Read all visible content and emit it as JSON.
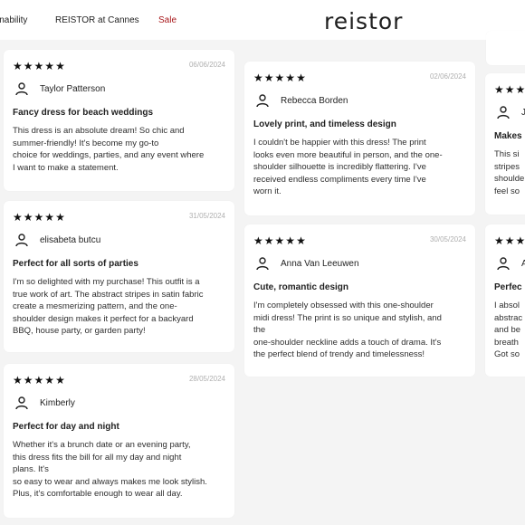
{
  "nav": {
    "sustainability": "inability",
    "cannes": "REISTOR at Cannes",
    "sale": "Sale",
    "logo": "reistor"
  },
  "reviews": [
    {
      "stars": 5,
      "date": "06/06/2024",
      "author": "Taylor Patterson",
      "title": "Fancy dress for beach weddings",
      "body": [
        "This dress is an absolute dream! So chic and",
        "summer-friendly! It's become my go-to",
        "choice for weddings, parties, and any event where",
        "I want to make a statement."
      ]
    },
    {
      "stars": 5,
      "date": "31/05/2024",
      "author": "elisabeta butcu",
      "title": "Perfect for all sorts of parties",
      "body": [
        "I'm so delighted with my purchase! This outfit is a",
        "true work of art. The abstract stripes in satin fabric",
        "create a mesmerizing pattern, and the one-",
        "shoulder design makes it perfect for a backyard",
        "BBQ, house party, or garden party!"
      ]
    },
    {
      "stars": 5,
      "date": "28/05/2024",
      "author": "Kimberly",
      "title": "Perfect for day and night",
      "body": [
        "Whether it's a brunch date or an evening party,",
        "this dress fits the bill for all my day and night",
        "plans. It's",
        "so easy to wear and always makes me look stylish.",
        "Plus, it's comfortable enough to wear all day."
      ]
    },
    {
      "stars": 5,
      "date": "02/06/2024",
      "author": "Rebecca Borden",
      "title": "Lovely print, and timeless design",
      "body": [
        "I couldn't be happier with this dress! The print",
        "looks even more beautiful in person, and the one-",
        "shoulder silhouette is incredibly flattering. I've",
        "received endless compliments every time I've",
        "worn it."
      ]
    },
    {
      "stars": 5,
      "date": "30/05/2024",
      "author": "Anna Van Leeuwen",
      "title": "Cute, romantic design",
      "body": [
        "I'm completely obsessed with this one-shoulder",
        "midi dress! The print is so unique and stylish, and",
        "the",
        "one-shoulder neckline adds a touch of drama. It's",
        "the perfect blend of trendy and timelessness!"
      ]
    },
    {
      "stars": 5,
      "date": "",
      "author": "J",
      "title": "Makes",
      "body": [
        "This si",
        "stripes",
        "shoulde",
        "feel so"
      ]
    },
    {
      "stars": 5,
      "date": "",
      "author": "A",
      "title": "Perfec",
      "body": [
        "I absol",
        "abstrac",
        "and be",
        "breath",
        "Got so"
      ]
    }
  ]
}
